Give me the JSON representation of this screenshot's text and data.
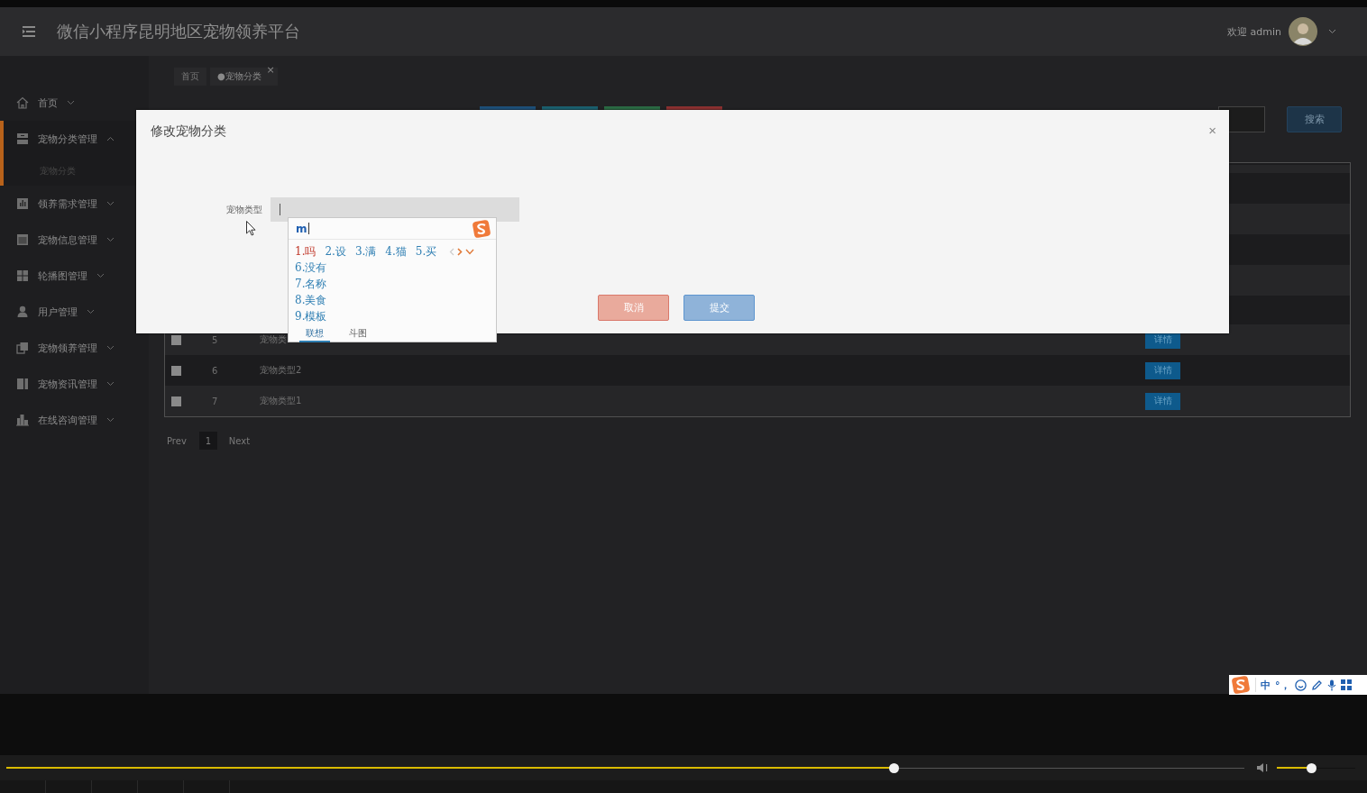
{
  "header": {
    "title": "微信小程序昆明地区宠物领养平台",
    "welcome": "欢迎 admin"
  },
  "sidebar": {
    "items": [
      {
        "label": "首页",
        "expanded": false
      },
      {
        "label": "宠物分类管理",
        "expanded": true,
        "children": [
          {
            "label": "宠物分类"
          }
        ]
      },
      {
        "label": "领养需求管理",
        "expanded": false
      },
      {
        "label": "宠物信息管理",
        "expanded": false
      },
      {
        "label": "轮播图管理",
        "expanded": false
      },
      {
        "label": "用户管理",
        "expanded": false
      },
      {
        "label": "宠物领养管理",
        "expanded": false
      },
      {
        "label": "宠物资讯管理",
        "expanded": false
      },
      {
        "label": "在线咨询管理",
        "expanded": false
      }
    ]
  },
  "tabs": [
    {
      "label": "首页",
      "selected": false
    },
    {
      "label": "●宠物分类",
      "selected": true,
      "close": "×"
    }
  ],
  "toolbar_buttons": [
    {
      "color": "#1d4f78"
    },
    {
      "color": "#1a5f6e"
    },
    {
      "color": "#2a6a43"
    },
    {
      "color": "#8a3030"
    }
  ],
  "search": {
    "button": "搜索"
  },
  "table": {
    "rows": [
      {
        "checked": false,
        "index": "5",
        "name": "宠物类",
        "action": "详情"
      },
      {
        "checked": false,
        "index": "6",
        "name": "宠物类型2",
        "action": "详情"
      },
      {
        "checked": false,
        "index": "7",
        "name": "宠物类型1",
        "action": "详情"
      }
    ]
  },
  "pagination": {
    "prev": "Prev",
    "pages": [
      {
        "label": "1",
        "selected": true
      }
    ],
    "next": "Next"
  },
  "dialog": {
    "title": "修改宠物分类",
    "close": "×",
    "fields": [
      {
        "label": "宠物类型",
        "focused": true
      }
    ],
    "buttons": [
      {
        "label": "取消",
        "kind": "cancel"
      },
      {
        "label": "提交",
        "kind": "submit"
      }
    ]
  },
  "ime": {
    "composition": "m",
    "candidates": [
      {
        "label": "1.吗",
        "selected": true
      },
      {
        "label": "2.设",
        "selected": false
      },
      {
        "label": "3.满",
        "selected": false
      },
      {
        "label": "4.猫",
        "selected": false
      },
      {
        "label": "5.买",
        "selected": false
      },
      {
        "label": "6.没有",
        "selected": false
      },
      {
        "label": "7.名称",
        "selected": false
      },
      {
        "label": "8.美食",
        "selected": false
      },
      {
        "label": "9.模板",
        "selected": false
      }
    ],
    "tabs": [
      {
        "label": "联想",
        "selected": true
      },
      {
        "label": "斗图",
        "selected": false
      }
    ]
  },
  "ime_bar": {
    "mode": "中",
    "punctuation": "°，"
  },
  "player": {
    "progress": {
      "level": 0.717
    },
    "volume": {
      "level": 0.44
    }
  }
}
